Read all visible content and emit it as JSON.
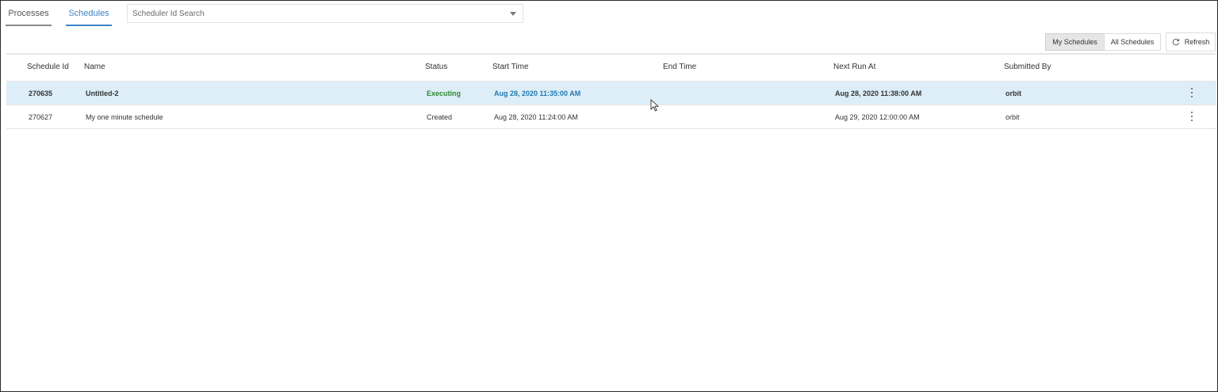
{
  "tabs": [
    {
      "label": "Processes",
      "active": false
    },
    {
      "label": "Schedules",
      "active": true
    }
  ],
  "search": {
    "placeholder": "Scheduler Id Search"
  },
  "toolbar": {
    "my_schedules_label": "My Schedules",
    "all_schedules_label": "All Schedules",
    "refresh_label": "Refresh",
    "selected_filter": "My Schedules"
  },
  "table": {
    "columns": [
      "Schedule Id",
      "Name",
      "Status",
      "Start Time",
      "End Time",
      "Next Run At",
      "Submitted By"
    ],
    "rows": [
      {
        "id": "270635",
        "name": "Untitled-2",
        "status": "Executing",
        "start": "Aug 28, 2020 11:35:00 AM",
        "end": "",
        "next": "Aug 28, 2020 11:38:00 AM",
        "by": "orbit",
        "selected": true
      },
      {
        "id": "270627",
        "name": "My one minute schedule",
        "status": "Created",
        "start": "Aug 28, 2020 11:24:00 AM",
        "end": "",
        "next": "Aug 29, 2020 12:00:00 AM",
        "by": "orbit",
        "selected": false
      }
    ]
  },
  "colors": {
    "accent": "#3b86c6",
    "status_executing": "#2e8b32",
    "selected_row": "#ddeef8"
  }
}
